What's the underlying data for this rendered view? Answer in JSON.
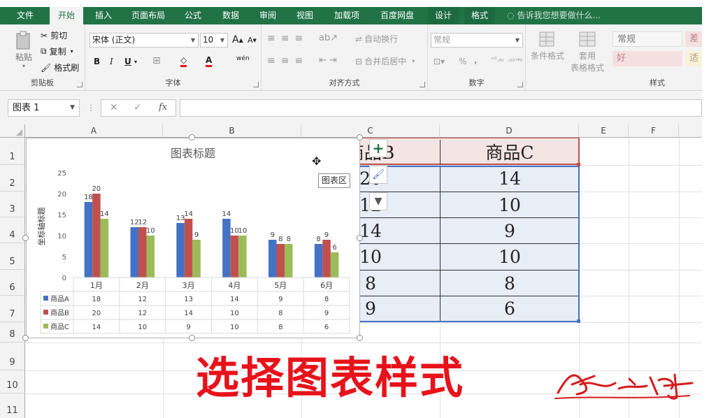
{
  "tabs": [
    "文件",
    "开始",
    "插入",
    "页面布局",
    "公式",
    "数据",
    "审阅",
    "视图",
    "加载项",
    "百度网盘",
    "设计",
    "格式"
  ],
  "tell_me": "告诉我您想要做什么...",
  "ribbon": {
    "clipboard": {
      "paste": "粘贴",
      "cut": "剪切",
      "copy": "复制",
      "format_painter": "格式刷",
      "label": "剪贴板"
    },
    "font": {
      "name": "宋体 (正文)",
      "size": "10",
      "grow": "A",
      "shrink": "A",
      "bold": "B",
      "italic": "I",
      "underline": "U",
      "wen": "wén",
      "label": "字体"
    },
    "align": {
      "wrap": "自动换行",
      "merge": "合并后居中",
      "label": "对齐方式"
    },
    "number": {
      "format": "常规",
      "percent": "%",
      "comma": ",",
      "label": "数字"
    },
    "styles": {
      "cond_format": "条件格式",
      "table_format_1": "套用",
      "table_format_2": "表格格式",
      "normal": "常规",
      "bad": "差",
      "good": "好",
      "neutral": "适",
      "label": "样式"
    }
  },
  "namebox": "图表 1",
  "columns": [
    "A",
    "B",
    "C",
    "D",
    "E",
    "F"
  ],
  "rows": [
    "1",
    "2",
    "3",
    "4",
    "5",
    "6",
    "7",
    "8",
    "9",
    "10",
    "11"
  ],
  "table": {
    "header_c": "商品B",
    "header_d": "商品C",
    "col_c": [
      "20",
      "12",
      "14",
      "10",
      "8",
      "9"
    ],
    "col_d": [
      "14",
      "10",
      "9",
      "10",
      "8",
      "6"
    ]
  },
  "chart_data": {
    "type": "bar",
    "title": "图表标题",
    "xlabel": "",
    "ylabel": "坐标轴标题",
    "ylim": [
      0,
      25
    ],
    "yticks": [
      "25",
      "20",
      "15",
      "10",
      "5",
      "0"
    ],
    "categories": [
      "1月",
      "2月",
      "3月",
      "4月",
      "5月",
      "6月"
    ],
    "series": [
      {
        "name": "商品A",
        "values": [
          18,
          12,
          13,
          14,
          9,
          8
        ],
        "color": "#4472c4"
      },
      {
        "name": "商品B",
        "values": [
          20,
          12,
          14,
          10,
          8,
          9
        ],
        "color": "#c0504d"
      },
      {
        "name": "商品C",
        "values": [
          14,
          10,
          9,
          10,
          8,
          6
        ],
        "color": "#9bbb59"
      }
    ],
    "data_table": true,
    "grid": false
  },
  "tooltip": "图表区",
  "overlay_text": "选择图表样式",
  "signature": "然之峰"
}
